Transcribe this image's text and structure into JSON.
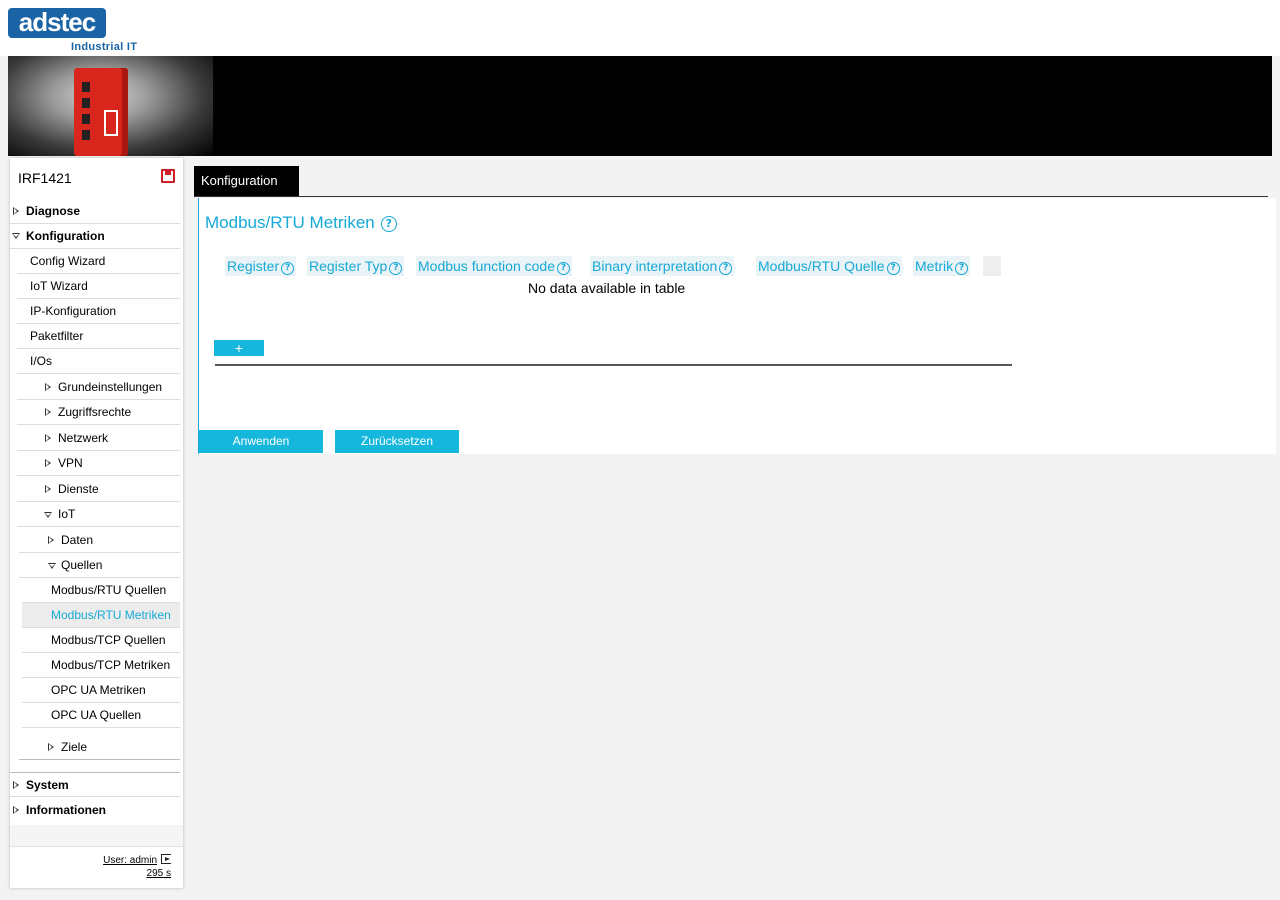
{
  "header": {
    "logo_text": "adstec",
    "logo_subtitle": "Industrial IT"
  },
  "sidebar": {
    "device_name": "IRF1421",
    "items": [
      {
        "label": "Diagnose"
      },
      {
        "label": "Konfiguration"
      },
      {
        "label": "Config Wizard"
      },
      {
        "label": "IoT Wizard"
      },
      {
        "label": "IP-Konfiguration"
      },
      {
        "label": "Paketfilter"
      },
      {
        "label": "I/Os"
      },
      {
        "label": "Grundeinstellungen"
      },
      {
        "label": "Zugriffsrechte"
      },
      {
        "label": "Netzwerk"
      },
      {
        "label": "VPN"
      },
      {
        "label": "Dienste"
      },
      {
        "label": "IoT"
      },
      {
        "label": "Daten"
      },
      {
        "label": "Quellen"
      },
      {
        "label": "Modbus/RTU Quellen"
      },
      {
        "label": "Modbus/RTU Metriken"
      },
      {
        "label": "Modbus/TCP Quellen"
      },
      {
        "label": "Modbus/TCP Metriken"
      },
      {
        "label": "OPC UA Metriken"
      },
      {
        "label": "OPC UA Quellen"
      },
      {
        "label": "Ziele"
      },
      {
        "label": "System"
      },
      {
        "label": "Informationen"
      }
    ],
    "footer": {
      "user_label": "User: admin",
      "timer": "295 s"
    }
  },
  "main": {
    "tab_label": "Konfiguration",
    "title": "Modbus/RTU Metriken",
    "help_glyph": "?",
    "table": {
      "columns": [
        "Register",
        "Register Typ",
        "Modbus function code",
        "Binary interpretation",
        "Modbus/RTU Quelle",
        "Metrik"
      ],
      "empty_message": "No data available in table"
    },
    "add_label": "+",
    "apply_label": "Anwenden",
    "reset_label": "Zurücksetzen"
  },
  "colors": {
    "accent": "#16a9d6",
    "button": "#16b7dd",
    "brand": "#1a64a6",
    "save_icon": "#d0202a"
  }
}
